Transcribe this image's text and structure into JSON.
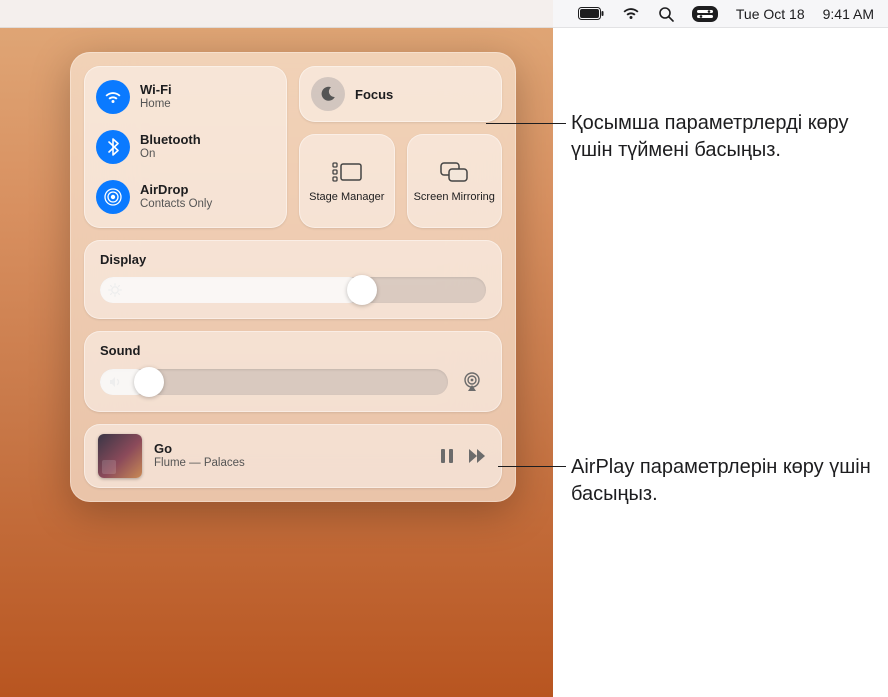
{
  "menubar": {
    "date": "Tue Oct 18",
    "time": "9:41 AM"
  },
  "connectivity": {
    "wifi": {
      "title": "Wi-Fi",
      "sub": "Home"
    },
    "bluetooth": {
      "title": "Bluetooth",
      "sub": "On"
    },
    "airdrop": {
      "title": "AirDrop",
      "sub": "Contacts Only"
    }
  },
  "focus": {
    "title": "Focus"
  },
  "stage_manager": {
    "label": "Stage Manager"
  },
  "screen_mirroring": {
    "label": "Screen Mirroring"
  },
  "display": {
    "label": "Display",
    "value_pct": 68
  },
  "sound": {
    "label": "Sound",
    "value_pct": 14
  },
  "now_playing": {
    "title": "Go",
    "sub": "Flume — Palaces"
  },
  "callouts": {
    "focus": "Қосымша параметрлерді көру үшін түймені басыңыз.",
    "airplay": "AirPlay параметрлерін көру үшін басыңыз."
  }
}
